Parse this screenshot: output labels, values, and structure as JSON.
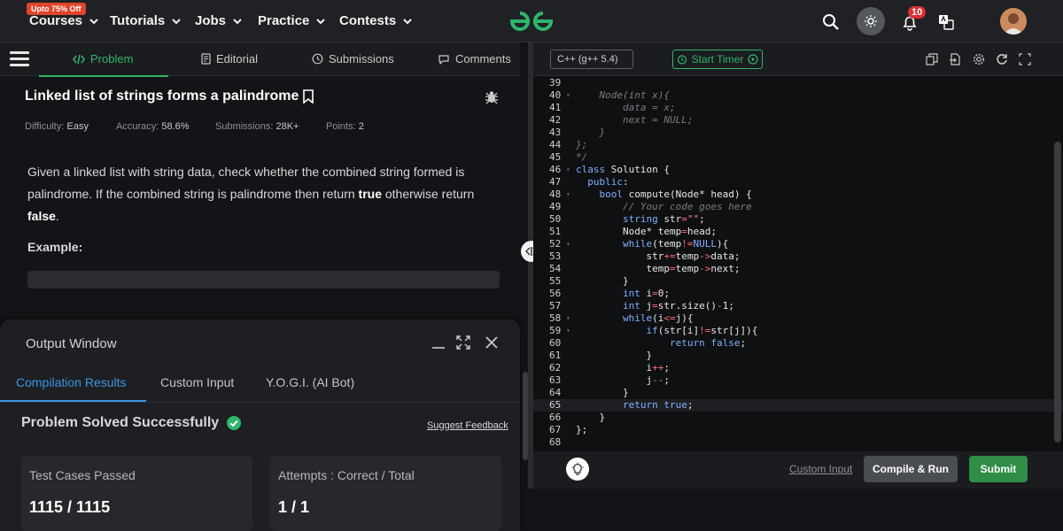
{
  "topbar": {
    "promo": "Upto 75% Off",
    "nav": [
      "Courses",
      "Tutorials",
      "Jobs",
      "Practice",
      "Contests"
    ],
    "notification_count": "10"
  },
  "problem_tabs": [
    {
      "label": "Problem",
      "icon": "code-icon"
    },
    {
      "label": "Editorial",
      "icon": "document-icon"
    },
    {
      "label": "Submissions",
      "icon": "history-icon"
    },
    {
      "label": "Comments",
      "icon": "comment-icon"
    }
  ],
  "problem": {
    "title": "Linked list of strings forms a palindrome",
    "difficulty_label": "Difficulty:",
    "difficulty": "Easy",
    "accuracy_label": "Accuracy:",
    "accuracy": "58.6%",
    "submissions_label": "Submissions:",
    "submissions": "28K+",
    "points_label": "Points:",
    "points": "2",
    "desc_1": "Given a linked list with string data, check whether the combined string formed is palindrome. If the combined string is palindrome then return ",
    "desc_true": "true",
    "desc_2": " otherwise return ",
    "desc_false": "false",
    "desc_3": ".",
    "example_label": "Example:"
  },
  "output": {
    "title": "Output Window",
    "tabs": [
      "Compilation Results",
      "Custom Input",
      "Y.O.G.I. (AI Bot)"
    ],
    "status": "Problem Solved Successfully",
    "feedback": "Suggest Feedback",
    "cards": [
      {
        "label": "Test Cases Passed",
        "value": "1115 / 1115"
      },
      {
        "label": "Attempts : Correct / Total",
        "value": "1 / 1"
      }
    ]
  },
  "editor": {
    "language": "C++ (g++ 5.4)",
    "timer_label": "Start Timer",
    "lines": [
      {
        "n": "39",
        "t": ""
      },
      {
        "n": "40",
        "t": "    Node(int x){"
      },
      {
        "n": "41",
        "t": "        data = x;"
      },
      {
        "n": "42",
        "t": "        next = NULL;"
      },
      {
        "n": "43",
        "t": "    }"
      },
      {
        "n": "44",
        "t": "};"
      },
      {
        "n": "45",
        "t": "*/"
      },
      {
        "n": "46",
        "t": "class Solution {"
      },
      {
        "n": "47",
        "t": "  public:"
      },
      {
        "n": "48",
        "t": "    bool compute(Node* head) {"
      },
      {
        "n": "49",
        "t": "        // Your code goes here"
      },
      {
        "n": "50",
        "t": "        string str=\"\";"
      },
      {
        "n": "51",
        "t": "        Node* temp=head;"
      },
      {
        "n": "52",
        "t": "        while(temp!=NULL){"
      },
      {
        "n": "53",
        "t": "            str+=temp->data;"
      },
      {
        "n": "54",
        "t": "            temp=temp->next;"
      },
      {
        "n": "55",
        "t": "        }"
      },
      {
        "n": "56",
        "t": "        int i=0;"
      },
      {
        "n": "57",
        "t": "        int j=str.size()-1;"
      },
      {
        "n": "58",
        "t": "        while(i<=j){"
      },
      {
        "n": "59",
        "t": "            if(str[i]!=str[j]){"
      },
      {
        "n": "60",
        "t": "                return false;"
      },
      {
        "n": "61",
        "t": "            }"
      },
      {
        "n": "62",
        "t": "            i++;"
      },
      {
        "n": "63",
        "t": "            j--;"
      },
      {
        "n": "64",
        "t": "        }"
      },
      {
        "n": "65",
        "t": "        return true;"
      },
      {
        "n": "66",
        "t": "    }"
      },
      {
        "n": "67",
        "t": "};"
      },
      {
        "n": "68",
        "t": ""
      }
    ],
    "custom_input": "Custom Input",
    "compile_run": "Compile & Run",
    "submit": "Submit"
  },
  "colors": {
    "brand_green": "#2fb56a",
    "accent_blue": "#3d95e0",
    "submit_green": "#2f8d46",
    "badge_red": "#d9302f"
  }
}
